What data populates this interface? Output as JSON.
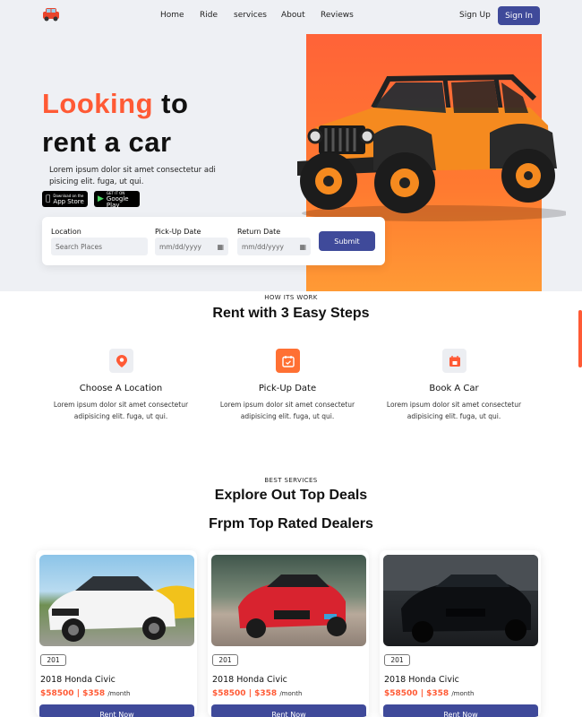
{
  "nav": {
    "items": [
      "Home",
      "Ride",
      "services",
      "About",
      "Reviews"
    ],
    "sign_up": "Sign Up",
    "sign_in": "Sign In"
  },
  "hero": {
    "title_accent": "Looking",
    "title_rest": "to",
    "title_line2": "rent a car",
    "description": "Lorem ipsum dolor sit amet consectetur adi pisicing elit. fuga, ut qui.",
    "app_store": {
      "small": "Download on the",
      "big": "App Store"
    },
    "google_play": {
      "small": "GET IT ON",
      "big": "Google Play"
    }
  },
  "search": {
    "location_label": "Location",
    "location_placeholder": "Search Places",
    "pickup_label": "Pick-Up Date",
    "pickup_value": "mm/dd/yyyy",
    "return_label": "Return Date",
    "return_value": "mm/dd/yyyy",
    "submit": "Submit"
  },
  "how": {
    "eyebrow": "HOW ITS WORK",
    "title": "Rent with 3 Easy Steps",
    "steps": [
      {
        "title": "Choose A Location",
        "text": "Lorem ipsum dolor sit amet consectetur adipisicing elit. fuga, ut qui.",
        "icon": "location-pin-icon"
      },
      {
        "title": "Pick-Up Date",
        "text": "Lorem ipsum dolor sit amet consectetur adipisicing elit. fuga, ut qui.",
        "icon": "calendar-check-icon"
      },
      {
        "title": "Book A Car",
        "text": "Lorem ipsum dolor sit amet consectetur adipisicing elit. fuga, ut qui.",
        "icon": "calendar-star-icon"
      }
    ]
  },
  "deals": {
    "eyebrow": "BEST SERVICES",
    "title_line1": "Explore Out Top Deals",
    "title_line2": "Frpm Top Rated Dealers",
    "cards": [
      {
        "badge": "201",
        "name": "2018 Honda Civic",
        "price": "$58500 | $358",
        "period": "/month",
        "button": "Rent Now",
        "car_color": "#f4f4f4"
      },
      {
        "badge": "201",
        "name": "2018 Honda Civic",
        "price": "$58500 | $358",
        "period": "/month",
        "button": "Rent Now",
        "car_color": "#d8232f"
      },
      {
        "badge": "201",
        "name": "2018 Honda Civic",
        "price": "$58500 | $358",
        "period": "/month",
        "button": "Rent Now",
        "car_color": "#111418"
      }
    ]
  },
  "colors": {
    "accent": "#ff5a35",
    "primary": "#3f4a9a",
    "hero_bg": "#eef0f4"
  }
}
